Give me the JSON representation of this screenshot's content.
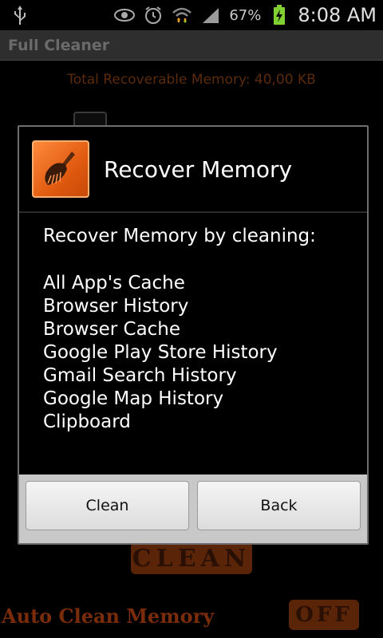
{
  "status_bar": {
    "icons": [
      "usb-icon",
      "eye-icon",
      "alarm-icon",
      "wifi-icon",
      "signal-icon",
      "battery-charging-icon"
    ],
    "battery": "67%",
    "time": "8:08 AM"
  },
  "app": {
    "title": "Full Cleaner",
    "total_label": "Total Recoverable Memory: 40,00 KB",
    "clean_button": "CLEAN",
    "auto_clean_label": "Auto Clean Memory",
    "toggle_state": "OFF"
  },
  "dialog": {
    "title": "Recover Memory",
    "icon": "broom-icon",
    "intro": "Recover Memory by cleaning:",
    "items": [
      "All App's Cache",
      "Browser History",
      "Browser Cache",
      "Google Play Store History",
      "Gmail Search History",
      "Google Map History",
      "Clipboard"
    ],
    "buttons": {
      "clean": "Clean",
      "back": "Back"
    }
  },
  "colors": {
    "accent": "#e8651a",
    "dialog_border": "#6e6e6e",
    "button_bar": "#c8c8c8"
  }
}
